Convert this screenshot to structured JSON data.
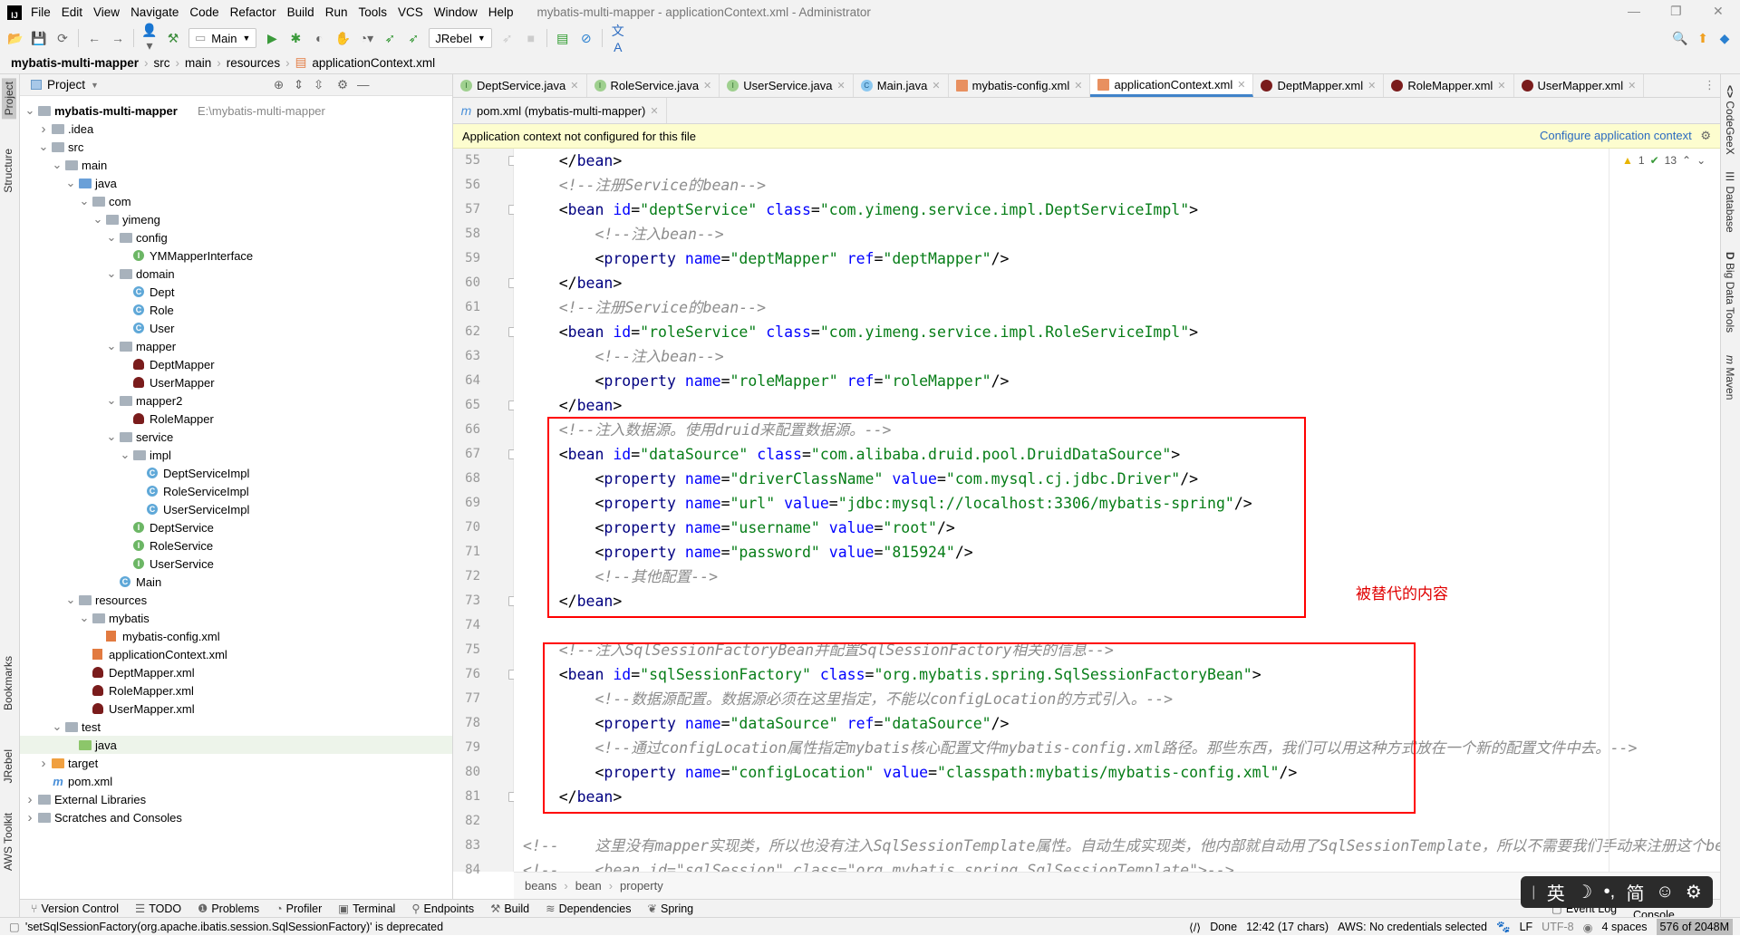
{
  "window": {
    "title": "mybatis-multi-mapper - applicationContext.xml - Administrator",
    "logo": "IJ"
  },
  "menu": [
    "File",
    "Edit",
    "View",
    "Navigate",
    "Code",
    "Refactor",
    "Build",
    "Run",
    "Tools",
    "VCS",
    "Window",
    "Help"
  ],
  "toolbar": {
    "run_config": "Main",
    "jrebel_config": "JRebel"
  },
  "breadcrumb": [
    "mybatis-multi-mapper",
    "src",
    "main",
    "resources",
    "applicationContext.xml"
  ],
  "project_panel": {
    "title": "Project"
  },
  "tree": [
    {
      "level": 0,
      "name": "mybatis-multi-mapper",
      "path": "E:\\mybatis-multi-mapper",
      "type": "module",
      "arrow": "open",
      "bold": true
    },
    {
      "level": 1,
      "name": ".idea",
      "type": "folder",
      "arrow": "closed"
    },
    {
      "level": 1,
      "name": "src",
      "type": "folder",
      "arrow": "open"
    },
    {
      "level": 2,
      "name": "main",
      "type": "folder",
      "arrow": "open"
    },
    {
      "level": 3,
      "name": "java",
      "type": "src",
      "arrow": "open"
    },
    {
      "level": 4,
      "name": "com",
      "type": "folder",
      "arrow": "open"
    },
    {
      "level": 5,
      "name": "yimeng",
      "type": "folder",
      "arrow": "open"
    },
    {
      "level": 6,
      "name": "config",
      "type": "folder",
      "arrow": "open"
    },
    {
      "level": 7,
      "name": "YMMapperInterface",
      "type": "interface"
    },
    {
      "level": 6,
      "name": "domain",
      "type": "folder",
      "arrow": "open"
    },
    {
      "level": 7,
      "name": "Dept",
      "type": "class"
    },
    {
      "level": 7,
      "name": "Role",
      "type": "class"
    },
    {
      "level": 7,
      "name": "User",
      "type": "class"
    },
    {
      "level": 6,
      "name": "mapper",
      "type": "folder",
      "arrow": "open"
    },
    {
      "level": 7,
      "name": "DeptMapper",
      "type": "mapper"
    },
    {
      "level": 7,
      "name": "UserMapper",
      "type": "mapper"
    },
    {
      "level": 6,
      "name": "mapper2",
      "type": "folder",
      "arrow": "open"
    },
    {
      "level": 7,
      "name": "RoleMapper",
      "type": "mapper"
    },
    {
      "level": 6,
      "name": "service",
      "type": "folder",
      "arrow": "open"
    },
    {
      "level": 7,
      "name": "impl",
      "type": "folder",
      "arrow": "open"
    },
    {
      "level": 8,
      "name": "DeptServiceImpl",
      "type": "class"
    },
    {
      "level": 8,
      "name": "RoleServiceImpl",
      "type": "class"
    },
    {
      "level": 8,
      "name": "UserServiceImpl",
      "type": "class"
    },
    {
      "level": 7,
      "name": "DeptService",
      "type": "interface"
    },
    {
      "level": 7,
      "name": "RoleService",
      "type": "interface"
    },
    {
      "level": 7,
      "name": "UserService",
      "type": "interface"
    },
    {
      "level": 6,
      "name": "Main",
      "type": "class"
    },
    {
      "level": 3,
      "name": "resources",
      "type": "folder",
      "arrow": "open"
    },
    {
      "level": 4,
      "name": "mybatis",
      "type": "folder",
      "arrow": "open"
    },
    {
      "level": 5,
      "name": "mybatis-config.xml",
      "type": "xml"
    },
    {
      "level": 4,
      "name": "applicationContext.xml",
      "type": "xml"
    },
    {
      "level": 4,
      "name": "DeptMapper.xml",
      "type": "mapper"
    },
    {
      "level": 4,
      "name": "RoleMapper.xml",
      "type": "mapper"
    },
    {
      "level": 4,
      "name": "UserMapper.xml",
      "type": "mapper"
    },
    {
      "level": 2,
      "name": "test",
      "type": "folder",
      "arrow": "open"
    },
    {
      "level": 3,
      "name": "java",
      "type": "testsrc",
      "selected": true
    },
    {
      "level": 1,
      "name": "target",
      "type": "target",
      "arrow": "closed"
    },
    {
      "level": 1,
      "name": "pom.xml",
      "type": "pom"
    },
    {
      "level": 0,
      "name": "External Libraries",
      "type": "lib",
      "arrow": "closed"
    },
    {
      "level": 0,
      "name": "Scratches and Consoles",
      "type": "scratch",
      "arrow": "closed"
    }
  ],
  "tabs_row1": [
    {
      "label": "DeptService.java",
      "icon": "interface"
    },
    {
      "label": "RoleService.java",
      "icon": "interface"
    },
    {
      "label": "UserService.java",
      "icon": "interface"
    },
    {
      "label": "Main.java",
      "icon": "class"
    },
    {
      "label": "mybatis-config.xml",
      "icon": "xml"
    },
    {
      "label": "applicationContext.xml",
      "icon": "xml",
      "active": true
    },
    {
      "label": "DeptMapper.xml",
      "icon": "mapper"
    },
    {
      "label": "RoleMapper.xml",
      "icon": "mapper"
    },
    {
      "label": "UserMapper.xml",
      "icon": "mapper"
    }
  ],
  "tabs_row2": [
    {
      "label": "pom.xml (mybatis-multi-mapper)",
      "icon": "pom"
    }
  ],
  "banner": {
    "message": "Application context not configured for this file",
    "action": "Configure application context"
  },
  "inspections": {
    "warnings": "1",
    "ok": "13"
  },
  "code_lines": [
    {
      "n": 55,
      "fold": true,
      "tokens": [
        [
          "p",
          "    </"
        ],
        [
          "t",
          "bean"
        ],
        [
          "p",
          ">"
        ]
      ]
    },
    {
      "n": 56,
      "tokens": [
        [
          "c",
          "    <!--注册Service的bean-->"
        ]
      ]
    },
    {
      "n": 57,
      "fold": true,
      "tokens": [
        [
          "p",
          "    <"
        ],
        [
          "t",
          "bean "
        ],
        [
          "a",
          "id"
        ],
        [
          "p",
          "="
        ],
        [
          "v",
          "\"deptService\" "
        ],
        [
          "a",
          "class"
        ],
        [
          "p",
          "="
        ],
        [
          "v",
          "\"com.yimeng.service.impl.DeptServiceImpl\""
        ],
        [
          "p",
          ">"
        ]
      ]
    },
    {
      "n": 58,
      "tokens": [
        [
          "c",
          "        <!--注入bean-->"
        ]
      ]
    },
    {
      "n": 59,
      "tokens": [
        [
          "p",
          "        <"
        ],
        [
          "t",
          "property "
        ],
        [
          "a",
          "name"
        ],
        [
          "p",
          "="
        ],
        [
          "v",
          "\"deptMapper\" "
        ],
        [
          "a",
          "ref"
        ],
        [
          "p",
          "="
        ],
        [
          "v",
          "\"deptMapper\""
        ],
        [
          "p",
          "/>"
        ]
      ]
    },
    {
      "n": 60,
      "fold": true,
      "tokens": [
        [
          "p",
          "    </"
        ],
        [
          "t",
          "bean"
        ],
        [
          "p",
          ">"
        ]
      ]
    },
    {
      "n": 61,
      "tokens": [
        [
          "c",
          "    <!--注册Service的bean-->"
        ]
      ]
    },
    {
      "n": 62,
      "fold": true,
      "tokens": [
        [
          "p",
          "    <"
        ],
        [
          "t",
          "bean "
        ],
        [
          "a",
          "id"
        ],
        [
          "p",
          "="
        ],
        [
          "v",
          "\"roleService\" "
        ],
        [
          "a",
          "class"
        ],
        [
          "p",
          "="
        ],
        [
          "v",
          "\"com.yimeng.service.impl.RoleServiceImpl\""
        ],
        [
          "p",
          ">"
        ]
      ]
    },
    {
      "n": 63,
      "tokens": [
        [
          "c",
          "        <!--注入bean-->"
        ]
      ]
    },
    {
      "n": 64,
      "tokens": [
        [
          "p",
          "        <"
        ],
        [
          "t",
          "property "
        ],
        [
          "a",
          "name"
        ],
        [
          "p",
          "="
        ],
        [
          "v",
          "\"roleMapper\" "
        ],
        [
          "a",
          "ref"
        ],
        [
          "p",
          "="
        ],
        [
          "v",
          "\"roleMapper\""
        ],
        [
          "p",
          "/>"
        ]
      ]
    },
    {
      "n": 65,
      "fold": true,
      "tokens": [
        [
          "p",
          "    </"
        ],
        [
          "t",
          "bean"
        ],
        [
          "p",
          ">"
        ]
      ]
    },
    {
      "n": 66,
      "tokens": [
        [
          "c",
          "    <!--注入数据源。使用druid来配置数据源。-->"
        ]
      ]
    },
    {
      "n": 67,
      "fold": true,
      "tokens": [
        [
          "p",
          "    <"
        ],
        [
          "t",
          "bean "
        ],
        [
          "a",
          "id"
        ],
        [
          "p",
          "="
        ],
        [
          "v",
          "\"dataSource\" "
        ],
        [
          "a",
          "class"
        ],
        [
          "p",
          "="
        ],
        [
          "v",
          "\"com.alibaba.druid.pool.DruidDataSource\""
        ],
        [
          "p",
          ">"
        ]
      ]
    },
    {
      "n": 68,
      "tokens": [
        [
          "p",
          "        <"
        ],
        [
          "t",
          "property "
        ],
        [
          "a",
          "name"
        ],
        [
          "p",
          "="
        ],
        [
          "v",
          "\"driverClassName\" "
        ],
        [
          "a",
          "value"
        ],
        [
          "p",
          "="
        ],
        [
          "v",
          "\"com.mysql.cj.jdbc.Driver\""
        ],
        [
          "p",
          "/>"
        ]
      ]
    },
    {
      "n": 69,
      "tokens": [
        [
          "p",
          "        <"
        ],
        [
          "t",
          "property "
        ],
        [
          "a",
          "name"
        ],
        [
          "p",
          "="
        ],
        [
          "v",
          "\"url\" "
        ],
        [
          "a",
          "value"
        ],
        [
          "p",
          "="
        ],
        [
          "v",
          "\"jdbc:mysql://localhost:3306/mybatis-spring\""
        ],
        [
          "p",
          "/>"
        ]
      ]
    },
    {
      "n": 70,
      "tokens": [
        [
          "p",
          "        <"
        ],
        [
          "t",
          "property "
        ],
        [
          "a",
          "name"
        ],
        [
          "p",
          "="
        ],
        [
          "v",
          "\"username\" "
        ],
        [
          "a",
          "value"
        ],
        [
          "p",
          "="
        ],
        [
          "v",
          "\"root\""
        ],
        [
          "p",
          "/>"
        ]
      ]
    },
    {
      "n": 71,
      "tokens": [
        [
          "p",
          "        <"
        ],
        [
          "t",
          "property "
        ],
        [
          "a",
          "name"
        ],
        [
          "p",
          "="
        ],
        [
          "v",
          "\"password\" "
        ],
        [
          "a",
          "value"
        ],
        [
          "p",
          "="
        ],
        [
          "v",
          "\"815924\""
        ],
        [
          "p",
          "/>"
        ]
      ]
    },
    {
      "n": 72,
      "tokens": [
        [
          "c",
          "        <!--其他配置-->"
        ]
      ]
    },
    {
      "n": 73,
      "fold": true,
      "tokens": [
        [
          "p",
          "    </"
        ],
        [
          "t",
          "bean"
        ],
        [
          "p",
          ">"
        ]
      ]
    },
    {
      "n": 74,
      "tokens": []
    },
    {
      "n": 75,
      "tokens": [
        [
          "c",
          "    <!--注入SqlSessionFactoryBean并配置SqlSessionFactory相关的信息-->"
        ]
      ]
    },
    {
      "n": 76,
      "fold": true,
      "tokens": [
        [
          "p",
          "    <"
        ],
        [
          "t",
          "bean "
        ],
        [
          "a",
          "id"
        ],
        [
          "p",
          "="
        ],
        [
          "v",
          "\"sqlSessionFactory\" "
        ],
        [
          "a",
          "class"
        ],
        [
          "p",
          "="
        ],
        [
          "v",
          "\"org.mybatis.spring.SqlSessionFactoryBean\""
        ],
        [
          "p",
          ">"
        ]
      ]
    },
    {
      "n": 77,
      "tokens": [
        [
          "c",
          "        <!--数据源配置。数据源必须在这里指定，不能以configLocation的方式引入。-->"
        ]
      ]
    },
    {
      "n": 78,
      "tokens": [
        [
          "p",
          "        <"
        ],
        [
          "t",
          "property "
        ],
        [
          "a",
          "name"
        ],
        [
          "p",
          "="
        ],
        [
          "v",
          "\"dataSource\" "
        ],
        [
          "a",
          "ref"
        ],
        [
          "p",
          "="
        ],
        [
          "v",
          "\"dataSource\""
        ],
        [
          "p",
          "/>"
        ]
      ]
    },
    {
      "n": 79,
      "tokens": [
        [
          "c",
          "        <!--通过configLocation属性指定mybatis核心配置文件mybatis-config.xml路径。那些东西，我们可以用这种方式放在一个新的配置文件中去。-->"
        ]
      ]
    },
    {
      "n": 80,
      "tokens": [
        [
          "p",
          "        <"
        ],
        [
          "t",
          "property "
        ],
        [
          "a",
          "name"
        ],
        [
          "p",
          "="
        ],
        [
          "v",
          "\"configLocation\" "
        ],
        [
          "a",
          "value"
        ],
        [
          "p",
          "="
        ],
        [
          "v",
          "\"classpath:mybatis/mybatis-config.xml\""
        ],
        [
          "p",
          "/>"
        ]
      ]
    },
    {
      "n": 81,
      "fold": true,
      "tokens": [
        [
          "p",
          "    </"
        ],
        [
          "t",
          "bean"
        ],
        [
          "p",
          ">"
        ]
      ]
    },
    {
      "n": 82,
      "tokens": []
    },
    {
      "n": 83,
      "tokens": [
        [
          "c",
          "<!--    这里没有mapper实现类，所以也没有注入SqlSessionTemplate属性。自动生成实现类，他内部就自动用了SqlSessionTemplate，所以不需要我们手动来注册这个bean"
        ]
      ]
    },
    {
      "n": 84,
      "tokens": [
        [
          "c",
          "<!--    <bean id=\"sqlSession\" class=\"org.mybatis.spring.SqlSessionTemplate\">-->"
        ]
      ]
    }
  ],
  "annotation": {
    "text": "被替代的内容",
    "color": "#e00000"
  },
  "editor_breadcrumb": [
    "beans",
    "bean",
    "property"
  ],
  "left_tool_tabs": [
    "Project",
    "Structure",
    "Bookmarks",
    "JRebel",
    "AWS Toolkit"
  ],
  "right_tool_tabs": [
    "CodeGeeX",
    "Database",
    "Big Data Tools",
    "Maven"
  ],
  "tool_windows": [
    {
      "label": "Version Control",
      "icon": "⑂"
    },
    {
      "label": "TODO",
      "icon": "☰"
    },
    {
      "label": "Problems",
      "icon": "❶"
    },
    {
      "label": "Profiler",
      "icon": "◔"
    },
    {
      "label": "Terminal",
      "icon": "▣"
    },
    {
      "label": "Endpoints",
      "icon": "⚲"
    },
    {
      "label": "Build",
      "icon": "⚒"
    },
    {
      "label": "Dependencies",
      "icon": "≋"
    },
    {
      "label": "Spring",
      "icon": "❦"
    },
    {
      "label": "Event Log",
      "icon": "▢"
    },
    {
      "label": "JRebel Console",
      "icon": "▢"
    }
  ],
  "status": {
    "message": "'setSqlSessionFactory(org.apache.ibatis.session.SqlSessionFactory)' is deprecated",
    "done": "Done",
    "position": "12:42 (17 chars)",
    "aws": "AWS: No credentials selected",
    "line_sep": "LF",
    "encoding": "UTF-8",
    "indent": "4 spaces",
    "memory": "576 of 2048M"
  },
  "ime": {
    "lang": "英",
    "punct": "•,",
    "script": "简"
  }
}
